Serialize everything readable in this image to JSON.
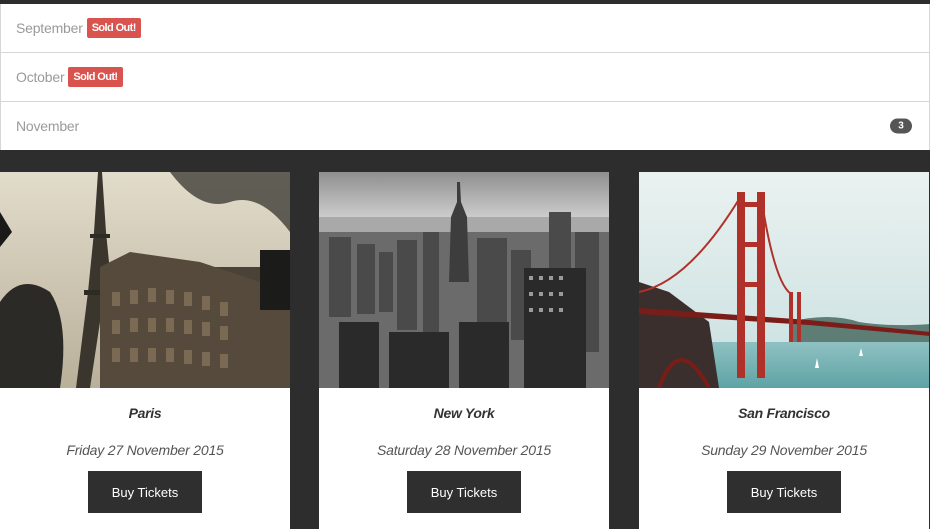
{
  "months": [
    {
      "label": "September",
      "badge": "Sold Out!"
    },
    {
      "label": "October",
      "badge": "Sold Out!"
    },
    {
      "label": "November",
      "count": "3"
    }
  ],
  "events": [
    {
      "city": "Paris",
      "date": "Friday 27 November 2015",
      "button": "Buy Tickets",
      "image": "eiffel-tower-photo"
    },
    {
      "city": "New York",
      "date": "Saturday 28 November 2015",
      "button": "Buy Tickets",
      "image": "new-york-skyline-photo"
    },
    {
      "city": "San Francisco",
      "date": "Sunday 29 November 2015",
      "button": "Buy Tickets",
      "image": "golden-gate-bridge-photo"
    }
  ],
  "colors": {
    "sold_out": "#d9534f",
    "dark": "#2d2d2d",
    "button": "#2f2f2f"
  }
}
